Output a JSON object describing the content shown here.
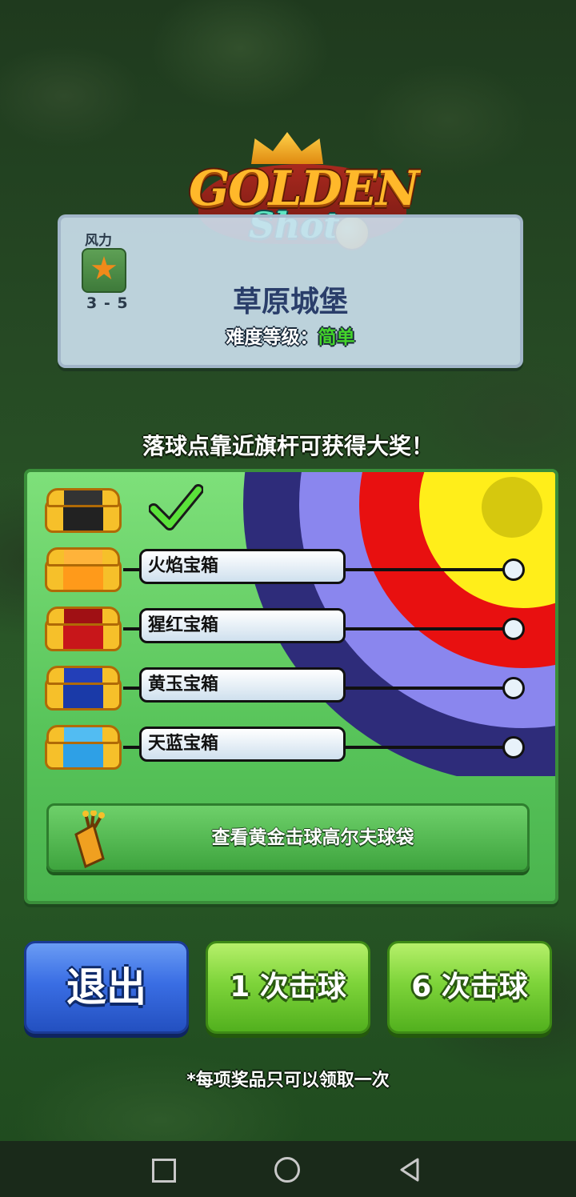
{
  "logo": {
    "line1": "GOLDEN",
    "line2": "Shot"
  },
  "course": {
    "wind_label": "风力",
    "wind_range": "3 - 5",
    "name": "草原城堡",
    "difficulty_label": "难度等级：",
    "difficulty_value": "简单"
  },
  "headline": "落球点靠近旗杆可获得大奖！",
  "rewards": [
    {
      "label": "",
      "claimed": true,
      "chest": "black-chest-icon"
    },
    {
      "label": "火焰宝箱",
      "claimed": false,
      "chest": "fire-chest-icon"
    },
    {
      "label": "猩红宝箱",
      "claimed": false,
      "chest": "scarlet-chest-icon"
    },
    {
      "label": "黄玉宝箱",
      "claimed": false,
      "chest": "topaz-chest-icon"
    },
    {
      "label": "天蓝宝箱",
      "claimed": false,
      "chest": "sky-blue-chest-icon"
    }
  ],
  "bag_button": {
    "label": "查看黄金击球高尔夫球袋",
    "icon": "golf-bag-icon"
  },
  "buttons": {
    "exit": "退出",
    "one_shot": "1 次击球",
    "six_shots": "6 次击球"
  },
  "footnote": "*每项奖品只可以领取一次",
  "colors": {
    "target_yellow": "#ffee1a",
    "target_red": "#e81010",
    "target_lavender": "#8a86ee",
    "target_navy": "#2e2c7a",
    "panel_green": "#58c45a",
    "difficulty_easy": "#44d42a",
    "exit_blue": "#3a6ee4",
    "shot_green": "#7ed43a"
  }
}
